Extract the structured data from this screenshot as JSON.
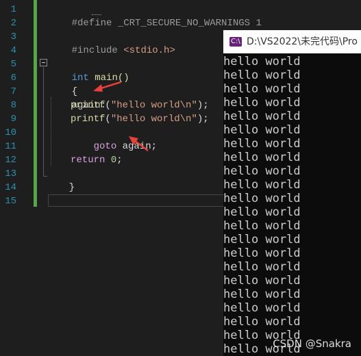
{
  "editor": {
    "line_numbers": [
      "1",
      "2",
      "3",
      "4",
      "5",
      "6",
      "7",
      "8",
      "9",
      "10",
      "11",
      "12",
      "13",
      "14",
      "15"
    ],
    "lines": {
      "l1_directive": "#define",
      "l1_macro": "_CRT_SECURE_NO_WARNINGS",
      "l1_value": "1",
      "l3_directive": "#include",
      "l3_header": "<stdio.h>",
      "l5_type": "int",
      "l5_func": "main()",
      "l6_brace": "{",
      "l7_label": "again:",
      "l8_func": "printf",
      "l8_open": "(",
      "l8_str": "\"hello world\\n\"",
      "l8_close": ");",
      "l9_func": "printf",
      "l9_open": "(",
      "l9_str": "\"hello world\\n\"",
      "l9_close": ");",
      "l10_kw": "goto",
      "l10_rest": "again;",
      "l12_kw": "return",
      "l12_num": "0",
      "l12_semi": ";",
      "l13_brace": "}"
    }
  },
  "console": {
    "title": "D:\\VS2022\\未完代码\\Pro",
    "icon": "visual-studio-icon",
    "output_lines": [
      "hello world",
      "hello world",
      "hello world",
      "hello world",
      "hello world",
      "hello world",
      "hello world",
      "hello world",
      "hello world",
      "hello world",
      "hello world",
      "hello world",
      "hello world",
      "hello world",
      "hello world",
      "hello world",
      "hello world",
      "hello world",
      "hello world",
      "hello world",
      "hello world",
      "hello world"
    ]
  },
  "annotations": {
    "arrow_color": "#e8413b",
    "arrow_icons": [
      "red-arrow-icon",
      "red-arrow-icon"
    ]
  },
  "watermark": "CSDN @Snakra",
  "colors": {
    "background": "#1e1e1e",
    "line_number": "#2b91af",
    "gutter_change": "#57a64a",
    "keyword": "#569cd6",
    "string": "#d69d85",
    "function": "#dcdcaa"
  }
}
